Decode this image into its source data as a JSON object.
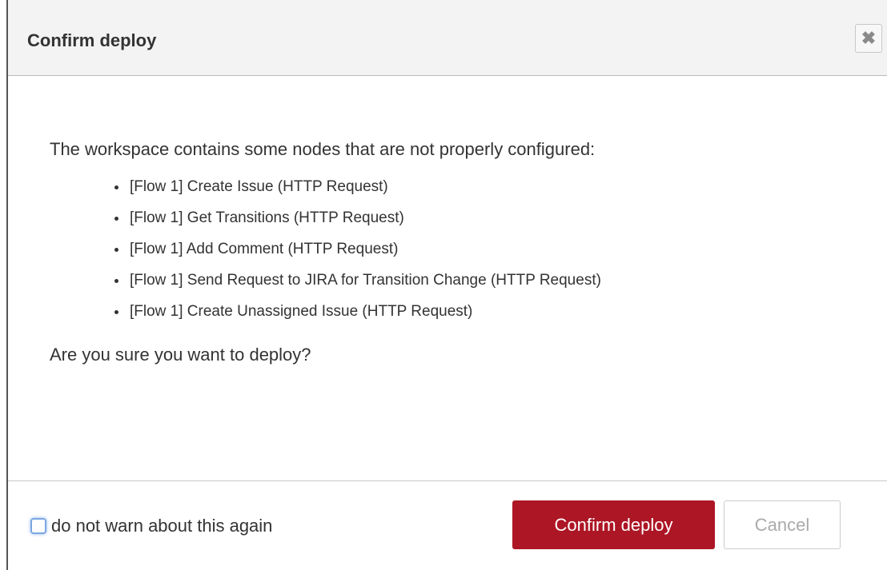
{
  "dialog": {
    "title": "Confirm deploy",
    "close_icon": "close-icon"
  },
  "content": {
    "intro": "The workspace contains some nodes that are not properly configured:",
    "nodes": [
      "[Flow 1] Create Issue (HTTP Request)",
      "[Flow 1] Get Transitions (HTTP Request)",
      "[Flow 1] Add Comment (HTTP Request)",
      "[Flow 1] Send Request to JIRA for Transition Change (HTTP Request)",
      "[Flow 1] Create Unassigned Issue (HTTP Request)"
    ],
    "question": "Are you sure you want to deploy?"
  },
  "footer": {
    "warn_label": "do not warn about this again",
    "warn_checked": false,
    "confirm_label": "Confirm deploy",
    "cancel_label": "Cancel"
  },
  "colors": {
    "confirm_bg": "#ad1625",
    "titlebar_bg": "#f3f3f3"
  }
}
